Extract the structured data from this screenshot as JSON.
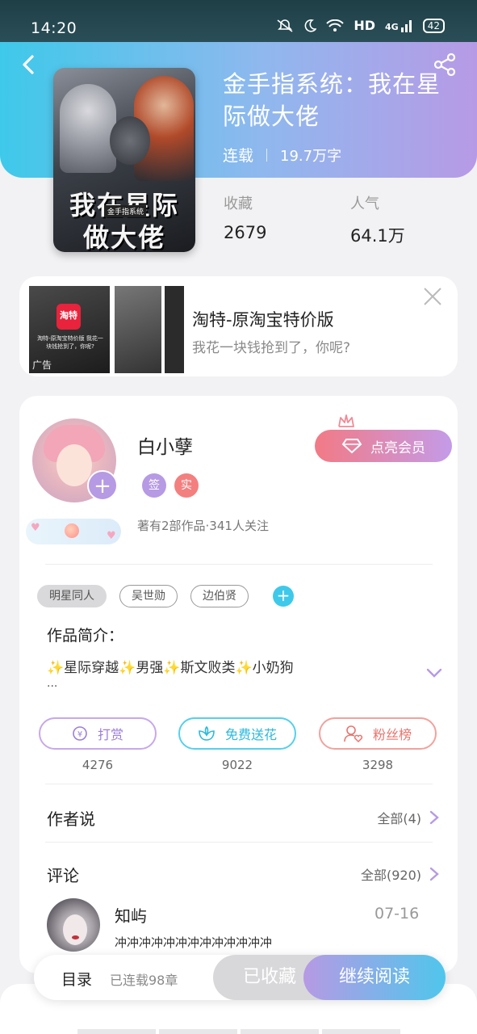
{
  "status_bar": {
    "time": "14:20",
    "hd": "HD",
    "network": "4G",
    "battery": "42"
  },
  "book": {
    "title": "金手指系统：我在星际做大佬",
    "status": "连载",
    "word_count": "19.7万字",
    "cover_title": "我在星际做大佬",
    "cover_subtitle": "金手指系统",
    "stats": [
      {
        "label": "收藏",
        "value": "2679"
      },
      {
        "label": "人气",
        "value": "64.1万"
      }
    ]
  },
  "ad": {
    "title": "淘特-原淘宝特价版",
    "description": "我花一块钱抢到了，你呢?",
    "logo_text": "淘特",
    "mini_text": "淘特-原淘宝特价版 我花一块钱抢到了，你呢?",
    "tag": "广告"
  },
  "author": {
    "name": "白小孽",
    "badges": [
      "签",
      "实"
    ],
    "info": "著有2部作品·341人关注",
    "vip_label": "点亮会员"
  },
  "tags": [
    "明星同人",
    "吴世勋",
    "边伯贤"
  ],
  "intro": {
    "label": "作品简介：",
    "text": "✨星际穿越✨男强✨斯文败类✨小奶狗",
    "more": "..."
  },
  "actions": [
    {
      "label": "打赏",
      "count": "4276"
    },
    {
      "label": "免费送花",
      "count": "9022"
    },
    {
      "label": "粉丝榜",
      "count": "3298"
    }
  ],
  "author_says": {
    "title": "作者说",
    "link": "全部(4)"
  },
  "comments": {
    "title": "评论",
    "link": "全部(920)",
    "items": [
      {
        "user": "知屿",
        "date": "07-16",
        "text": "冲冲冲冲冲冲冲冲冲冲冲冲冲"
      }
    ]
  },
  "bottom_bar": {
    "toc": "目录",
    "chapters": "已连载98章",
    "favorited": "已收藏",
    "continue": "继续阅读"
  },
  "colors": {
    "header_start": "#3ec9ea",
    "header_end": "#b79ae6",
    "accent_purple": "#b69ae4",
    "accent_cyan": "#3ec9ea",
    "accent_red": "#f37f7f"
  }
}
